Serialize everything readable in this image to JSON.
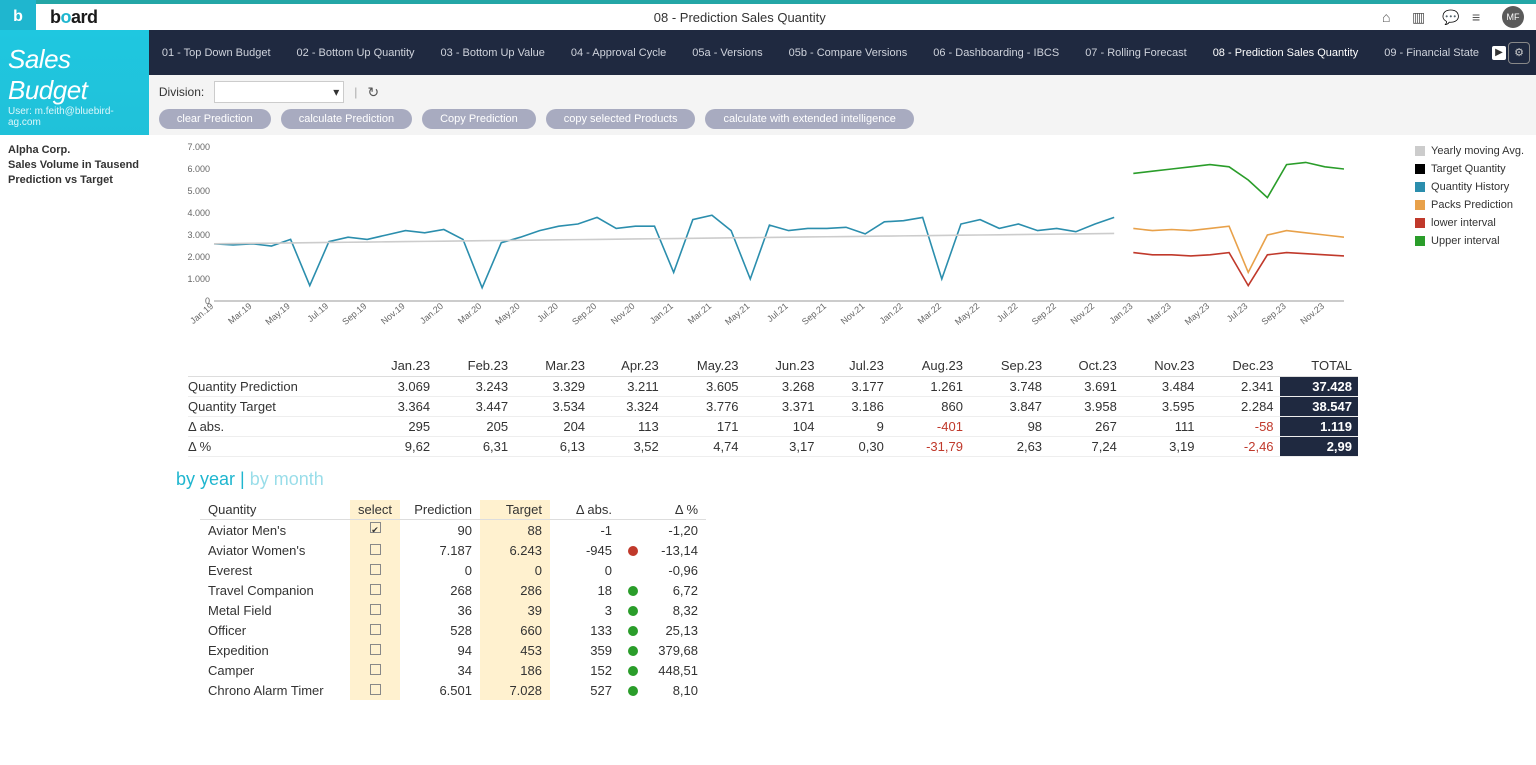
{
  "header": {
    "logo_text": "board",
    "page_title": "08 - Prediction Sales Quantity",
    "avatar_initials": "MF"
  },
  "sidebar": {
    "title": "Sales Budget",
    "user_line": "User: m.feith@bluebird-ag.com"
  },
  "tabs": [
    "01 - Top Down Budget",
    "02 - Bottom Up Quantity",
    "03 - Bottom Up Value",
    "04 - Approval Cycle",
    "05a - Versions",
    "05b - Compare Versions",
    "06 - Dashboarding - IBCS",
    "07 - Rolling Forecast",
    "08 - Prediction Sales Quantity",
    "09 - Financial State"
  ],
  "subbar": {
    "division_label": "Division:",
    "buttons": {
      "b1": "clear Prediction",
      "b2": "calculate Prediction",
      "b3": "Copy Prediction",
      "b4": "copy selected Products",
      "b5": "calculate with extended intelligence"
    }
  },
  "chart_info": {
    "l1": "Alpha Corp.",
    "l2": "Sales Volume in Tausend",
    "l3": "Prediction vs Target"
  },
  "legend": {
    "l1": "Yearly moving Avg.",
    "l2": "Target Quantity",
    "l3": "Quantity History",
    "l4": "Packs Prediction",
    "l5": "lower interval",
    "l6": "Upper interval"
  },
  "chart_data": {
    "type": "line",
    "ylim": [
      0,
      7000
    ],
    "yticks": [
      0,
      1000,
      2000,
      3000,
      4000,
      5000,
      6000,
      7000
    ],
    "x": [
      "Jan.19",
      "Mar.19",
      "May.19",
      "Jul.19",
      "Sep.19",
      "Nov.19",
      "Jan.20",
      "Mar.20",
      "May.20",
      "Jul.20",
      "Sep.20",
      "Nov.20",
      "Jan.21",
      "Mar.21",
      "May.21",
      "Jul.21",
      "Sep.21",
      "Nov.21",
      "Jan.22",
      "Mar.22",
      "May.22",
      "Jul.22",
      "Sep.22",
      "Nov.22",
      "Jan.23",
      "Mar.23",
      "May.23",
      "Jul.23",
      "Sep.23",
      "Nov.23"
    ],
    "series": [
      {
        "name": "Quantity History",
        "color": "#2b8ead",
        "values": [
          2600,
          2550,
          2600,
          2500,
          2800,
          700,
          2700,
          2900,
          2800,
          3000,
          3200,
          3100,
          3250,
          2800,
          600,
          2650,
          2900,
          3200,
          3400,
          3500,
          3800,
          3300,
          3400,
          3400,
          1300,
          3700,
          3900,
          3200,
          1000,
          3450,
          3200,
          3300,
          3300,
          3350,
          3050,
          3600,
          3650,
          3800,
          1000,
          3500,
          3700,
          3300,
          3500,
          3200,
          3300,
          3150,
          3500,
          3800,
          null,
          null,
          null,
          null,
          null,
          null,
          null,
          null,
          null,
          null,
          null,
          null
        ]
      },
      {
        "name": "Packs Prediction",
        "color": "#e8a14a",
        "values_tail": [
          3300,
          3200,
          3250,
          3200,
          3300,
          3400,
          1300,
          3000,
          3200,
          3100,
          3000,
          2900
        ]
      },
      {
        "name": "lower interval",
        "color": "#c0392b",
        "values_tail": [
          2200,
          2100,
          2100,
          2050,
          2100,
          2200,
          700,
          2100,
          2200,
          2150,
          2100,
          2050
        ]
      },
      {
        "name": "Upper interval",
        "color": "#2a9d2a",
        "values_tail": [
          5800,
          5900,
          6000,
          6100,
          6200,
          6100,
          5500,
          4700,
          6200,
          6300,
          6100,
          6000
        ]
      },
      {
        "name": "Yearly moving Avg.",
        "color": "#bbbbbb",
        "values": "flat_around_3000"
      }
    ]
  },
  "monthly_table": {
    "cols": [
      "Jan.23",
      "Feb.23",
      "Mar.23",
      "Apr.23",
      "May.23",
      "Jun.23",
      "Jul.23",
      "Aug.23",
      "Sep.23",
      "Oct.23",
      "Nov.23",
      "Dec.23",
      "TOTAL"
    ],
    "rows": [
      {
        "label": "Quantity Prediction",
        "v": [
          "3.069",
          "3.243",
          "3.329",
          "3.211",
          "3.605",
          "3.268",
          "3.177",
          "1.261",
          "3.748",
          "3.691",
          "3.484",
          "2.341",
          "37.428"
        ]
      },
      {
        "label": "Quantity Target",
        "v": [
          "3.364",
          "3.447",
          "3.534",
          "3.324",
          "3.776",
          "3.371",
          "3.186",
          "860",
          "3.847",
          "3.958",
          "3.595",
          "2.284",
          "38.547"
        ]
      },
      {
        "label": "Δ abs.",
        "v": [
          "295",
          "205",
          "204",
          "113",
          "171",
          "104",
          "9",
          "-401",
          "98",
          "267",
          "111",
          "-58",
          "1.119"
        ]
      },
      {
        "label": "Δ %",
        "v": [
          "9,62",
          "6,31",
          "6,13",
          "3,52",
          "4,74",
          "3,17",
          "0,30",
          "-31,79",
          "2,63",
          "7,24",
          "3,19",
          "-2,46",
          "2,99"
        ]
      }
    ]
  },
  "switch": {
    "a": "by year",
    "b": "by month"
  },
  "product_table": {
    "cols": [
      "Quantity",
      "select",
      "Prediction",
      "Target",
      "Δ abs.",
      "",
      "Δ %"
    ],
    "rows": [
      {
        "name": "Aviator Men's",
        "sel": true,
        "pred": "90",
        "tgt": "88",
        "abs": "-1",
        "dot": "",
        "pct": "-1,20"
      },
      {
        "name": "Aviator Women's",
        "sel": false,
        "pred": "7.187",
        "tgt": "6.243",
        "abs": "-945",
        "dot": "r",
        "pct": "-13,14"
      },
      {
        "name": "Everest",
        "sel": false,
        "pred": "0",
        "tgt": "0",
        "abs": "0",
        "dot": "",
        "pct": "-0,96"
      },
      {
        "name": "Travel Companion",
        "sel": false,
        "pred": "268",
        "tgt": "286",
        "abs": "18",
        "dot": "g",
        "pct": "6,72"
      },
      {
        "name": "Metal Field",
        "sel": false,
        "pred": "36",
        "tgt": "39",
        "abs": "3",
        "dot": "g",
        "pct": "8,32"
      },
      {
        "name": "Officer",
        "sel": false,
        "pred": "528",
        "tgt": "660",
        "abs": "133",
        "dot": "g",
        "pct": "25,13"
      },
      {
        "name": "Expedition",
        "sel": false,
        "pred": "94",
        "tgt": "453",
        "abs": "359",
        "dot": "g",
        "pct": "379,68"
      },
      {
        "name": "Camper",
        "sel": false,
        "pred": "34",
        "tgt": "186",
        "abs": "152",
        "dot": "g",
        "pct": "448,51"
      },
      {
        "name": "Chrono Alarm Timer",
        "sel": false,
        "pred": "6.501",
        "tgt": "7.028",
        "abs": "527",
        "dot": "g",
        "pct": "8,10"
      }
    ]
  }
}
